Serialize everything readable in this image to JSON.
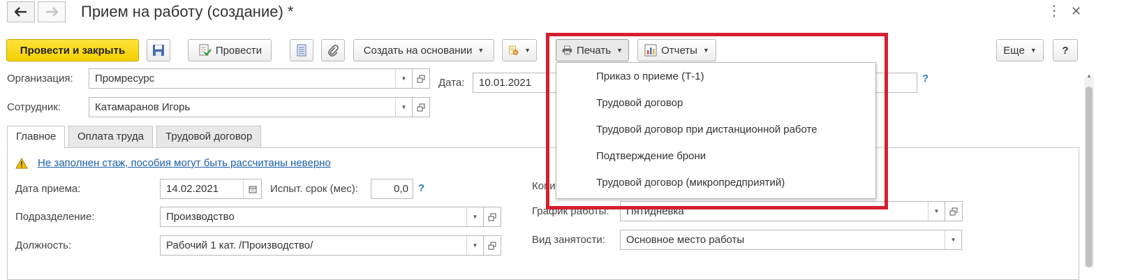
{
  "window": {
    "title": "Прием на работу (создание) *",
    "back_icon": "arrow-left-icon",
    "forward_icon": "arrow-right-icon",
    "more_icon": "⋮",
    "close_icon": "✕"
  },
  "toolbar": {
    "post_and_close": "Провести и закрыть",
    "post": "Провести",
    "create_based_on": "Создать на основании",
    "print": "Печать",
    "reports": "Отчеты",
    "more": "Еще",
    "help": "?"
  },
  "print_menu": {
    "items": [
      "Приказ о приеме (Т-1)",
      "Трудовой договор",
      "Трудовой договор при дистанционной работе",
      "Подтверждение брони",
      "Трудовой договор (микропредприятий)"
    ]
  },
  "header": {
    "organization_label": "Организация:",
    "organization_value": "Промресурс",
    "date_label": "Дата:",
    "date_value": "10.01.2021",
    "employee_label": "Сотрудник:",
    "employee_value": "Катамаранов Игорь",
    "help": "?"
  },
  "tabs": [
    "Главное",
    "Оплата труда",
    "Трудовой договор"
  ],
  "main": {
    "warning_text": "Не заполнен стаж, пособия могут быть рассчитаны неверно",
    "hire_date_label": "Дата приема:",
    "hire_date_value": "14.02.2021",
    "probation_label": "Испыт. срок (мес):",
    "probation_value": "0,0",
    "probation_help": "?",
    "department_label": "Подразделение:",
    "department_value": "Производство",
    "position_label": "Должность:",
    "position_value": "Рабочий 1 кат. /Производство/",
    "copies_label_partial": "Копи",
    "schedule_label": "График работы:",
    "schedule_value": "Пятидневка",
    "employment_type_label": "Вид занятости:",
    "employment_type_value": "Основное место работы"
  },
  "colors": {
    "primary_button": "#f5cf00",
    "highlight_border": "#d3202f",
    "link": "#1b5fa6",
    "help": "#2d7ab8"
  }
}
